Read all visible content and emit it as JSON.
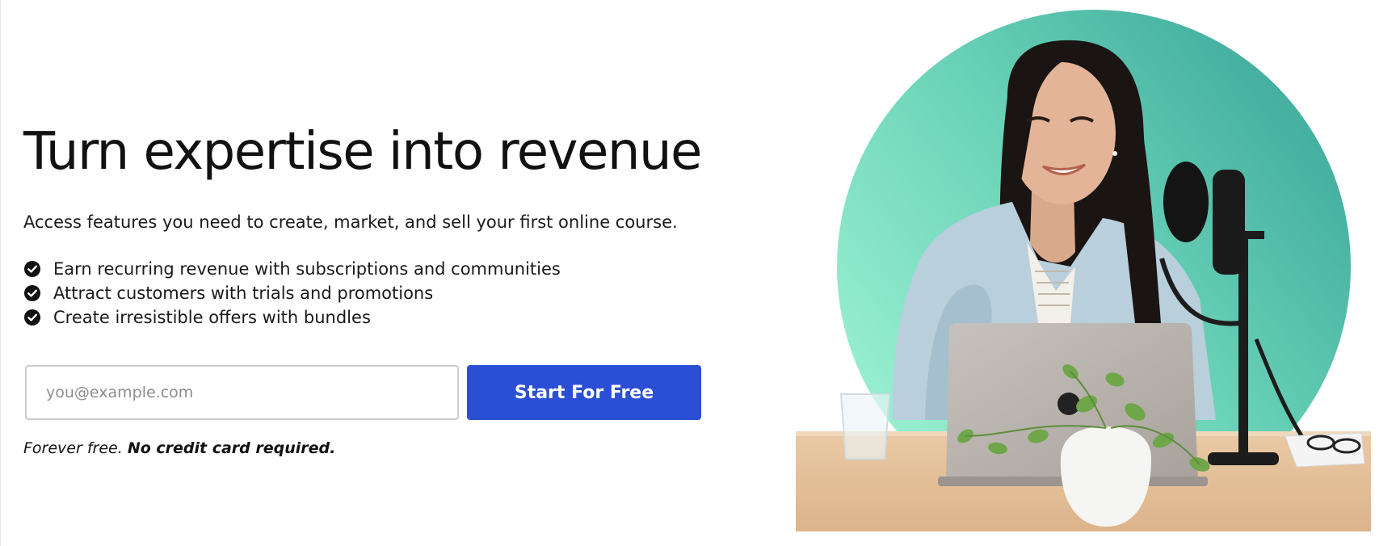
{
  "hero": {
    "title": "Turn expertise into revenue",
    "subtitle": "Access features you need to create, market, and sell your first online course.",
    "benefits": [
      "Earn recurring revenue with subscriptions and communities",
      "Attract customers with trials and promotions",
      "Create irresistible offers with bundles"
    ],
    "benefit_icon": "check-circle-icon"
  },
  "signup": {
    "email_placeholder": "you@example.com",
    "email_value": "",
    "cta_label": "Start For Free",
    "note_prefix": "Forever free.",
    "note_emphasis": "No credit card required."
  },
  "colors": {
    "cta": "#2b4fd4",
    "circle_light": "#9af2d2",
    "circle_dark": "#3aa59a",
    "text": "#111111"
  }
}
